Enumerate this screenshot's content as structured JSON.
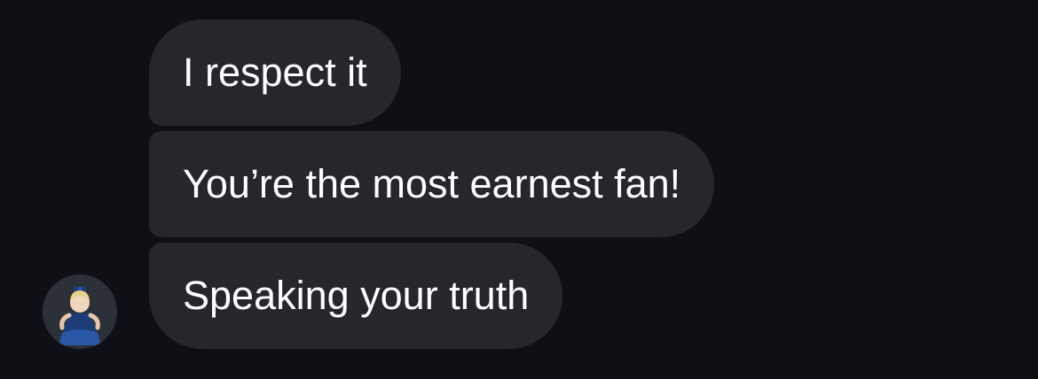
{
  "thread": {
    "messages": [
      {
        "text": "I respect it"
      },
      {
        "text": "You’re the most earnest fan!"
      },
      {
        "text": "Speaking your truth"
      }
    ],
    "sender_avatar": {
      "icon": "child-portrait-avatar"
    }
  },
  "colors": {
    "background": "#0e1016",
    "bubble": "#25272c",
    "text": "#ffffff"
  }
}
